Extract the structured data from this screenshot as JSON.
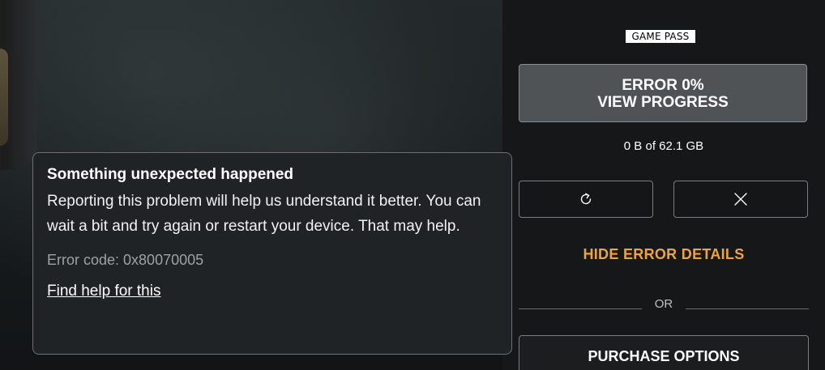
{
  "badge": {
    "label": "GAME PASS"
  },
  "status_button": {
    "line1": "ERROR 0%",
    "line2": "VIEW PROGRESS"
  },
  "download": {
    "progress_text": "0 B of 62.1 GB"
  },
  "actions": {
    "retry_icon": "retry-icon",
    "cancel_icon": "close-icon"
  },
  "hide_details": {
    "label": "HIDE ERROR DETAILS"
  },
  "separator": {
    "label": "OR"
  },
  "purchase": {
    "label": "PURCHASE OPTIONS"
  },
  "dialog": {
    "title": "Something unexpected happened",
    "message": "Reporting this problem will help us understand it better. You can wait a bit and try again or restart your device. That may help.",
    "error_code": "Error code: 0x80070005",
    "help_link": "Find help for this"
  },
  "colors": {
    "accent_orange": "#f0a432",
    "button_bg": "#505356",
    "dialog_bg": "#202325",
    "page_bg": "#151719"
  }
}
